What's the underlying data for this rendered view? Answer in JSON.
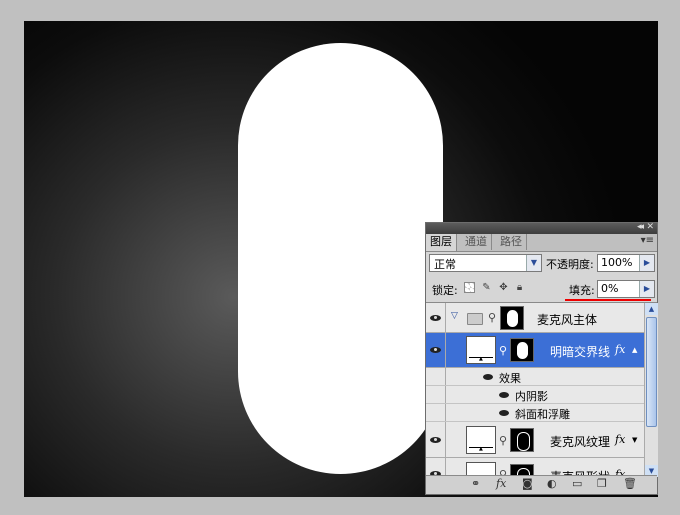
{
  "panel": {
    "tabs": [
      {
        "label": "图层",
        "active": true
      },
      {
        "label": "通道",
        "active": false
      },
      {
        "label": "路径",
        "active": false
      }
    ],
    "blend_mode": "正常",
    "opacity_label": "不透明度:",
    "opacity_value": "100%",
    "lock_label": "锁定:",
    "fill_label": "填充:",
    "fill_value": "0%",
    "highlight_color": "#3c6fd6",
    "annotation_color": "#e00000"
  },
  "layers": [
    {
      "name": "麦克风主体",
      "type": "group",
      "visible": true,
      "expanded": true
    },
    {
      "name": "明暗交界线",
      "type": "layer",
      "visible": true,
      "selected": true,
      "fx": "fx",
      "effects_label": "效果",
      "effects": [
        "内阴影",
        "斜面和浮雕"
      ]
    },
    {
      "name": "麦克风纹理",
      "type": "layer",
      "visible": true,
      "fx": "fx"
    },
    {
      "name": "麦克风形状",
      "type": "layer",
      "visible": true,
      "fx": "fx"
    }
  ],
  "bottom_icons": [
    "link-icon",
    "fx-icon",
    "mask-icon",
    "adjustment-icon",
    "group-icon",
    "new-layer-icon",
    "trash-icon"
  ],
  "canvas": {
    "background": "dark radial gradient",
    "shape": "white rounded capsule"
  }
}
